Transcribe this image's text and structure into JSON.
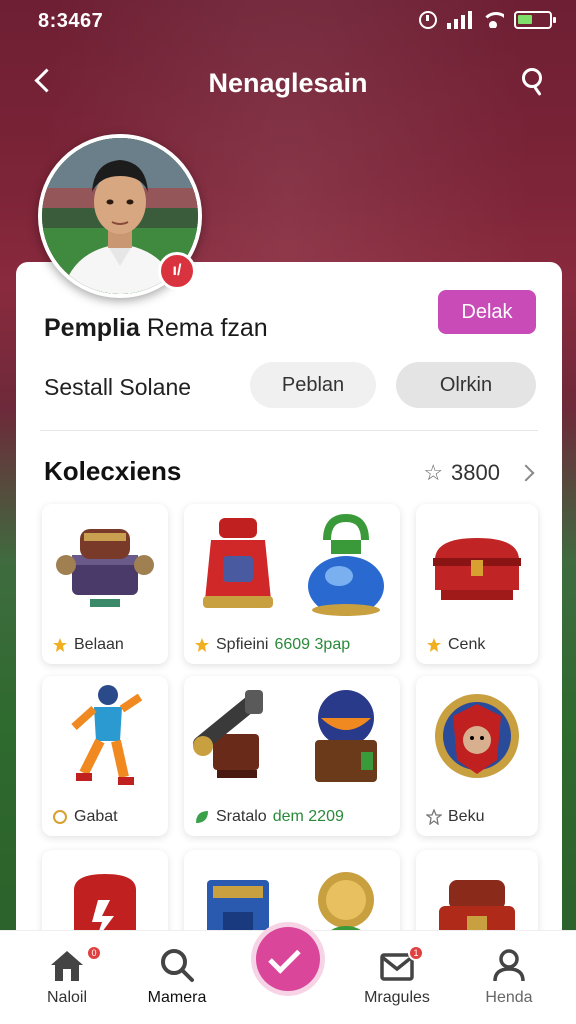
{
  "status_bar": {
    "time": "8:3467"
  },
  "header": {
    "title": "Nenaglesain"
  },
  "profile": {
    "name_bold": "Pemplia",
    "name_rest": "Rema fzan",
    "follow_label": "Delak",
    "sub_label": "Sestall Solane",
    "pill_1": "Peblan",
    "pill_2": "Olrkin"
  },
  "collection": {
    "title": "Kolecxiens",
    "count": "3800",
    "tiles": [
      {
        "label": "Belaan",
        "highlight": ""
      },
      {
        "label": "Spfieini",
        "highlight": "6609 3pap"
      },
      {
        "label": "Cenk",
        "highlight": ""
      },
      {
        "label": "Gabat",
        "highlight": ""
      },
      {
        "label": "Sratalo",
        "highlight": "dem 2209"
      },
      {
        "label": "Beku",
        "highlight": ""
      }
    ]
  },
  "bottom_nav": {
    "items": [
      {
        "label": "Naloil",
        "badge": "0"
      },
      {
        "label": "Mamera"
      },
      {
        "label": "Mragules",
        "badge": "1"
      },
      {
        "label": "Henda"
      }
    ]
  },
  "colors": {
    "accent": "#c84bb8",
    "fab": "#d9469a",
    "highlight_text": "#2a8a3a"
  }
}
